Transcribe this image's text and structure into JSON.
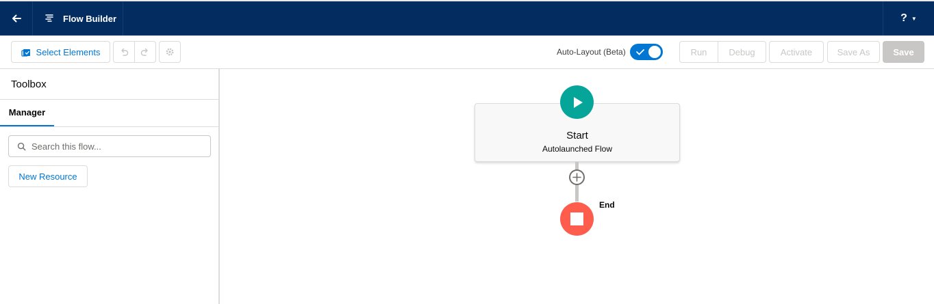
{
  "header": {
    "app_title": "Flow Builder",
    "help_label": "?"
  },
  "toolbar": {
    "select_elements_label": "Select Elements",
    "auto_layout_label": "Auto-Layout (Beta)",
    "auto_layout_on": true,
    "run_label": "Run",
    "debug_label": "Debug",
    "activate_label": "Activate",
    "save_as_label": "Save As",
    "save_label": "Save"
  },
  "sidebar": {
    "title": "Toolbox",
    "tabs": [
      {
        "label": "Manager",
        "active": true
      }
    ],
    "search": {
      "placeholder": "Search this flow...",
      "value": ""
    },
    "new_resource_label": "New Resource"
  },
  "canvas": {
    "start": {
      "title": "Start",
      "subtitle": "Autolaunched Flow"
    },
    "end": {
      "label": "End"
    }
  },
  "colors": {
    "header_bg": "#032d60",
    "brand_blue": "#0176d3",
    "start_green": "#06a59a",
    "end_red": "#fe5c4c",
    "disabled_gray": "#c9c7c5"
  }
}
